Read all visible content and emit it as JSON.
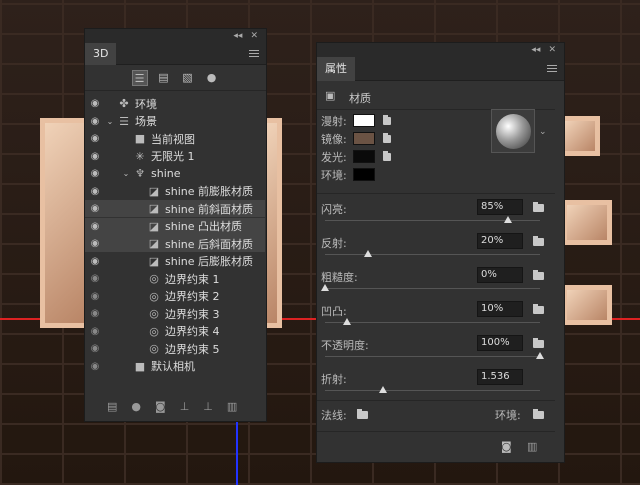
{
  "panel3d": {
    "title": "3D",
    "layers": [
      {
        "label": "环境",
        "icon": "environment-icon",
        "indent": 0,
        "eye": true
      },
      {
        "label": "场景",
        "icon": "scene-icon",
        "indent": 0,
        "eye": true
      },
      {
        "label": "当前视图",
        "icon": "camera-icon",
        "indent": 1,
        "eye": true
      },
      {
        "label": "无限光 1",
        "icon": "light-icon",
        "indent": 1,
        "eye": true
      },
      {
        "label": "shine",
        "icon": "mesh-icon",
        "indent": 1,
        "eye": true
      },
      {
        "label": "shine 前膨胀材质",
        "icon": "material-icon",
        "indent": 2,
        "eye": true
      },
      {
        "label": "shine 前斜面材质",
        "icon": "material-icon",
        "indent": 2,
        "eye": true,
        "hl": true
      },
      {
        "label": "shine 凸出材质",
        "icon": "material-icon",
        "indent": 2,
        "eye": true,
        "hl": true
      },
      {
        "label": "shine 后斜面材质",
        "icon": "material-icon",
        "indent": 2,
        "eye": true,
        "hl": true
      },
      {
        "label": "shine 后膨胀材质",
        "icon": "material-icon",
        "indent": 2,
        "eye": true
      },
      {
        "label": "边界约束 1",
        "icon": "constraint-icon",
        "indent": 2,
        "eye": false
      },
      {
        "label": "边界约束 2",
        "icon": "constraint-icon",
        "indent": 2,
        "eye": false
      },
      {
        "label": "边界约束 3",
        "icon": "constraint-icon",
        "indent": 2,
        "eye": false
      },
      {
        "label": "边界约束 4",
        "icon": "constraint-icon",
        "indent": 2,
        "eye": false
      },
      {
        "label": "边界约束 5",
        "icon": "constraint-icon",
        "indent": 2,
        "eye": false
      },
      {
        "label": "默认相机",
        "icon": "camera-icon",
        "indent": 1,
        "eye": false
      }
    ]
  },
  "props": {
    "title": "属性",
    "subtitle": "材质",
    "colors": [
      {
        "label": "漫射:",
        "color": "#ffffff"
      },
      {
        "label": "镜像:",
        "color": "#6b5344"
      },
      {
        "label": "发光:",
        "color": "#0a0a0a"
      },
      {
        "label": "环境:",
        "color": "#000000"
      }
    ],
    "sliders": [
      {
        "label": "闪亮:",
        "value": "85%",
        "pos": 0.85,
        "folder": true
      },
      {
        "label": "反射:",
        "value": "20%",
        "pos": 0.2,
        "folder": true
      },
      {
        "label": "粗糙度:",
        "value": "0%",
        "pos": 0.0,
        "folder": true
      },
      {
        "label": "凹凸:",
        "value": "10%",
        "pos": 0.1,
        "folder": true
      },
      {
        "label": "不透明度:",
        "value": "100%",
        "pos": 1.0,
        "folder": true
      },
      {
        "label": "折射:",
        "value": "1.536",
        "pos": 0.27,
        "folder": false
      }
    ],
    "normal_label": "法线:",
    "env_label": "环境:"
  }
}
